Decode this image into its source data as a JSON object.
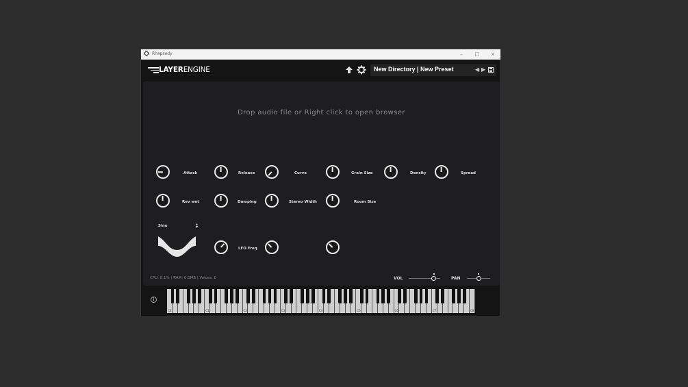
{
  "window": {
    "title": "Rhapsody"
  },
  "header": {
    "brand": {
      "part1": "LAYER",
      "part2": "ENGINE"
    },
    "upload_icon": "upload-arrow-icon",
    "settings_icon": "gear-icon",
    "preset": {
      "directory": "New Directory",
      "separator": " | ",
      "name": "New Preset",
      "label": "New Directory | New Preset"
    }
  },
  "panel": {
    "drop_text": "Drop audio file or Right click to open browser",
    "knobs_row1": [
      {
        "label": "Attack",
        "angle": 270
      },
      {
        "label": "Release",
        "angle": 0
      },
      {
        "label": "Curve",
        "angle": 225
      },
      {
        "label": "Grain Size",
        "angle": 0
      },
      {
        "label": "Density",
        "angle": 0
      },
      {
        "label": "Spread",
        "angle": 0
      }
    ],
    "knobs_row2": [
      {
        "label": "Rev wet",
        "angle": 0
      },
      {
        "label": "Damping",
        "angle": 0
      },
      {
        "label": "Stereo Width",
        "angle": 0
      },
      {
        "label": "Room Size",
        "angle": 0
      }
    ],
    "lfo": {
      "waveform": "Sine",
      "freq_label": "LFO Freq"
    }
  },
  "footer": {
    "stats": "CPU: 0.1% | RAM: 0.0MB | Voices: 0",
    "vol_label": "VOL",
    "vol_value": 0.8,
    "pan_label": "PAN",
    "pan_value": 0.5
  },
  "keyboard": {
    "octave_labels": [
      "C0",
      "C1",
      "C2",
      "C3",
      "C4",
      "C5",
      "C6",
      "C7"
    ]
  },
  "colors": {
    "background": "#2d2d2d",
    "panel": "#1e1e20",
    "knob": "#ececec"
  }
}
